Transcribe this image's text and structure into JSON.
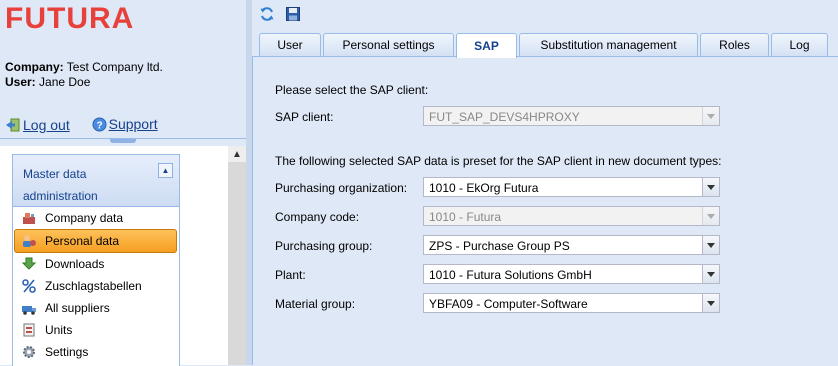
{
  "logo": {
    "text": "FUTURA",
    "color": "#e8413c"
  },
  "user_info": {
    "company_label": "Company:",
    "company_value": "Test Company ltd.",
    "user_label": "User:",
    "user_value": "Jane Doe"
  },
  "links": {
    "logout": "Log out",
    "support": "Support"
  },
  "nav_panel": {
    "title": "Master data administration",
    "items": [
      {
        "label": "Company data",
        "icon": "company-icon"
      },
      {
        "label": "Personal data",
        "icon": "personal-icon",
        "active": true
      },
      {
        "label": "Downloads",
        "icon": "download-icon"
      },
      {
        "label": "Zuschlagstabellen",
        "icon": "percent-icon"
      },
      {
        "label": "All suppliers",
        "icon": "suppliers-icon"
      },
      {
        "label": "Units",
        "icon": "units-icon"
      },
      {
        "label": "Settings",
        "icon": "settings-icon"
      }
    ]
  },
  "toolbar": {
    "refresh_icon": "refresh-icon",
    "save_icon": "save-icon"
  },
  "tabs": [
    "User",
    "Personal settings",
    "SAP",
    "Substitution management",
    "Roles",
    "Log"
  ],
  "active_tab": "SAP",
  "form": {
    "intro": "Please select the SAP client:",
    "sap_client_label": "SAP client:",
    "sap_client_value": "FUT_SAP_DEVS4HPROXY",
    "preset_text": "The following selected SAP data is preset for the SAP client in new document types:",
    "fields": [
      {
        "label": "Purchasing organization:",
        "value": "1010 - EkOrg Futura",
        "disabled": false
      },
      {
        "label": "Company code:",
        "value": "1010 - Futura",
        "disabled": true
      },
      {
        "label": "Purchasing group:",
        "value": "ZPS - Purchase Group PS",
        "disabled": false
      },
      {
        "label": "Plant:",
        "value": "1010 - Futura Solutions GmbH",
        "disabled": false
      },
      {
        "label": "Material group:",
        "value": "YBFA09 - Computer-Software",
        "disabled": false
      }
    ]
  }
}
